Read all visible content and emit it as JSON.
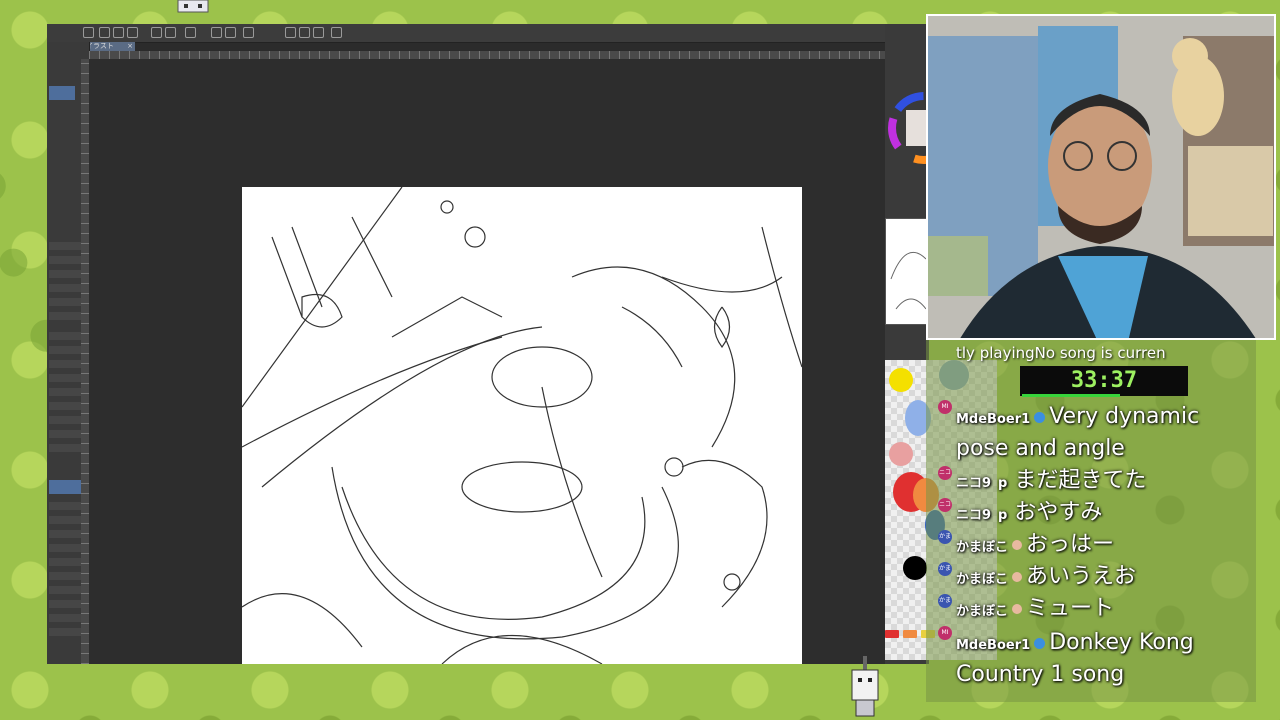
{
  "app": {
    "tab_label": "イラスト",
    "tab_close": "×"
  },
  "overlay": {
    "song_text": "tly playingNo song is curren",
    "timer": "33:37"
  },
  "chat": {
    "messages": [
      {
        "user": "MdeBoer1",
        "text": "Very dynamic",
        "avatar": "MI"
      },
      {
        "user": "",
        "text": "pose and angle",
        "avatar": ""
      },
      {
        "user": "ニコ9",
        "text": "まだ起きてた",
        "avatar": "ニコ"
      },
      {
        "user": "ニコ9",
        "text": "おやすみ",
        "avatar": "ニコ"
      },
      {
        "user": "かまぼこ",
        "text": "おっはー",
        "avatar": "かま"
      },
      {
        "user": "かまぼこ",
        "text": "あいうえお",
        "avatar": "かま"
      },
      {
        "user": "かまぼこ",
        "text": "ミュート",
        "avatar": "かま"
      },
      {
        "user": "MdeBoer1",
        "text": "Donkey Kong",
        "avatar": "MI"
      },
      {
        "user": "",
        "text": "Country 1 song",
        "avatar": ""
      }
    ],
    "suffix_p": "p"
  },
  "colors": {
    "accent_timer": "#9df061",
    "palette_swatches": [
      "#f4e000",
      "#8fb0e8",
      "#e07070",
      "#f07a20",
      "#3060c0",
      "#000000"
    ]
  },
  "icons": [
    "undo-icon",
    "redo-icon",
    "save-icon",
    "pen-icon",
    "eraser-icon",
    "hand-icon"
  ]
}
